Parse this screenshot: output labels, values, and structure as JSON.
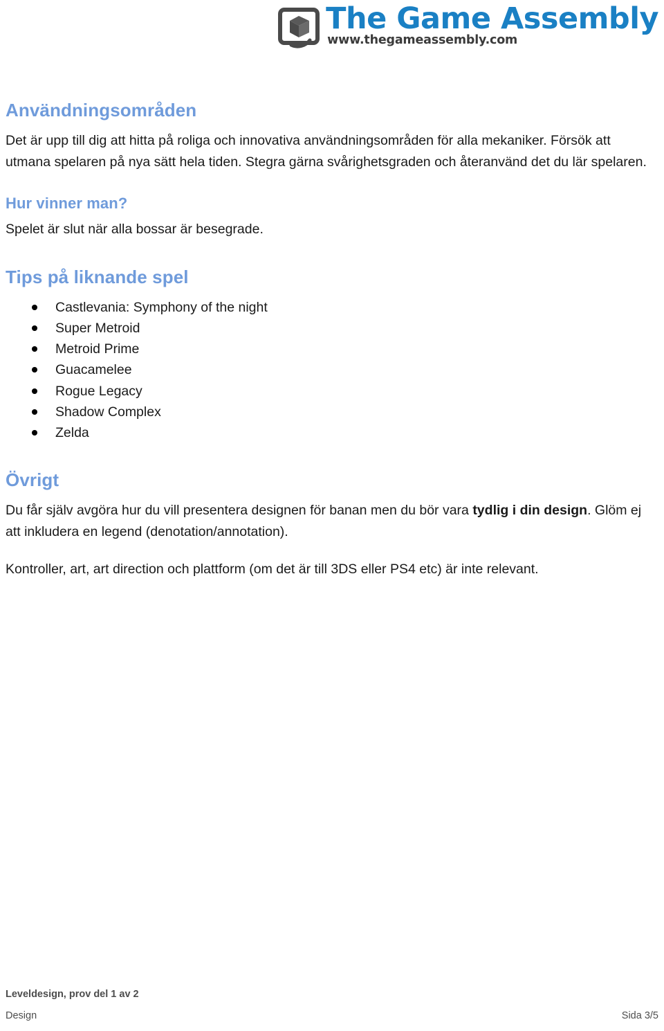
{
  "header": {
    "logo": {
      "icon": "cube-logo-icon",
      "wordmark": "The Game Assembly",
      "url": "www.thegameassembly.com",
      "brand_blue": "#1a80c4",
      "mark_gray": "#4a4a4a"
    }
  },
  "document": {
    "heading_color": "#6f9bdb",
    "sections": {
      "usage": {
        "heading": "Användningsområden",
        "body": "Det är upp till dig att hitta på roliga och innovativa användningsområden för alla mekaniker. Försök att utmana spelaren på nya sätt hela tiden. Stegra gärna svårighetsgraden och återanvänd det du lär spelaren."
      },
      "win": {
        "heading": "Hur vinner man?",
        "body": "Spelet är slut när alla bossar är besegrade."
      },
      "tips": {
        "heading": "Tips på liknande spel",
        "items": [
          "Castlevania: Symphony of the night",
          "Super Metroid",
          "Metroid Prime",
          "Guacamelee",
          "Rogue Legacy",
          "Shadow Complex",
          "Zelda"
        ]
      },
      "misc": {
        "heading": "Övrigt",
        "paragraph1_before": "Du får själv avgöra hur du vill presentera designen för banan men du bör vara ",
        "paragraph1_bold": "tydlig i din design",
        "paragraph1_after": ". Glöm ej att inkludera en legend (denotation/annotation).",
        "paragraph2": "Kontroller, art, art direction och plattform (om det är till 3DS eller PS4 etc) är inte relevant."
      }
    }
  },
  "footer": {
    "title": "Leveldesign, prov del 1 av 2",
    "category": "Design",
    "page_number": "Sida 3/5"
  }
}
